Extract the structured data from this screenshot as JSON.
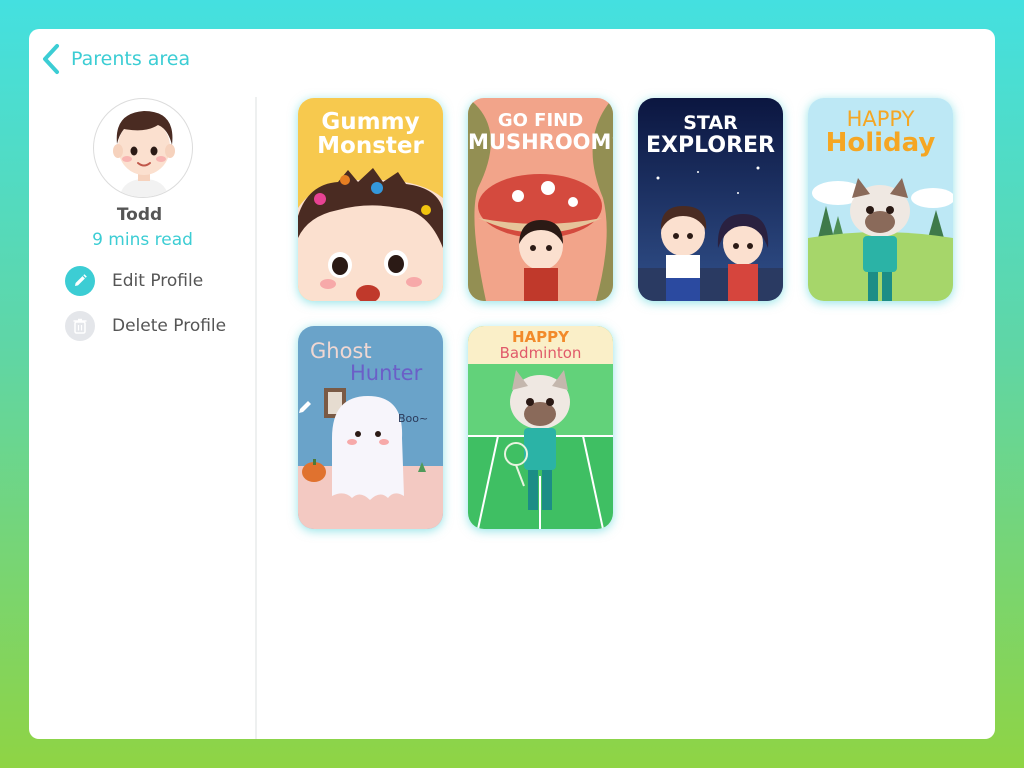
{
  "header": {
    "back_label": "Parents area"
  },
  "profile": {
    "name": "Todd",
    "read_time": "9 mins read",
    "actions": [
      {
        "label": "Edit Profile",
        "icon": "pencil-icon"
      },
      {
        "label": "Delete Profile",
        "icon": "trash-icon"
      }
    ]
  },
  "books": [
    {
      "line1": "Gummy",
      "line2": "Monster"
    },
    {
      "line1": "GO FIND",
      "line2": "MUSHROOMS"
    },
    {
      "line1": "STAR",
      "line2": "EXPLORER"
    },
    {
      "line1": "HAPPY",
      "line2": "Holiday"
    },
    {
      "line1": "Ghost",
      "line2": "Hunter",
      "extra": "Boo~"
    },
    {
      "line1": "HAPPY",
      "line2": "Badminton"
    }
  ],
  "colors": {
    "accent": "#3ccdd4",
    "text": "#555555"
  }
}
